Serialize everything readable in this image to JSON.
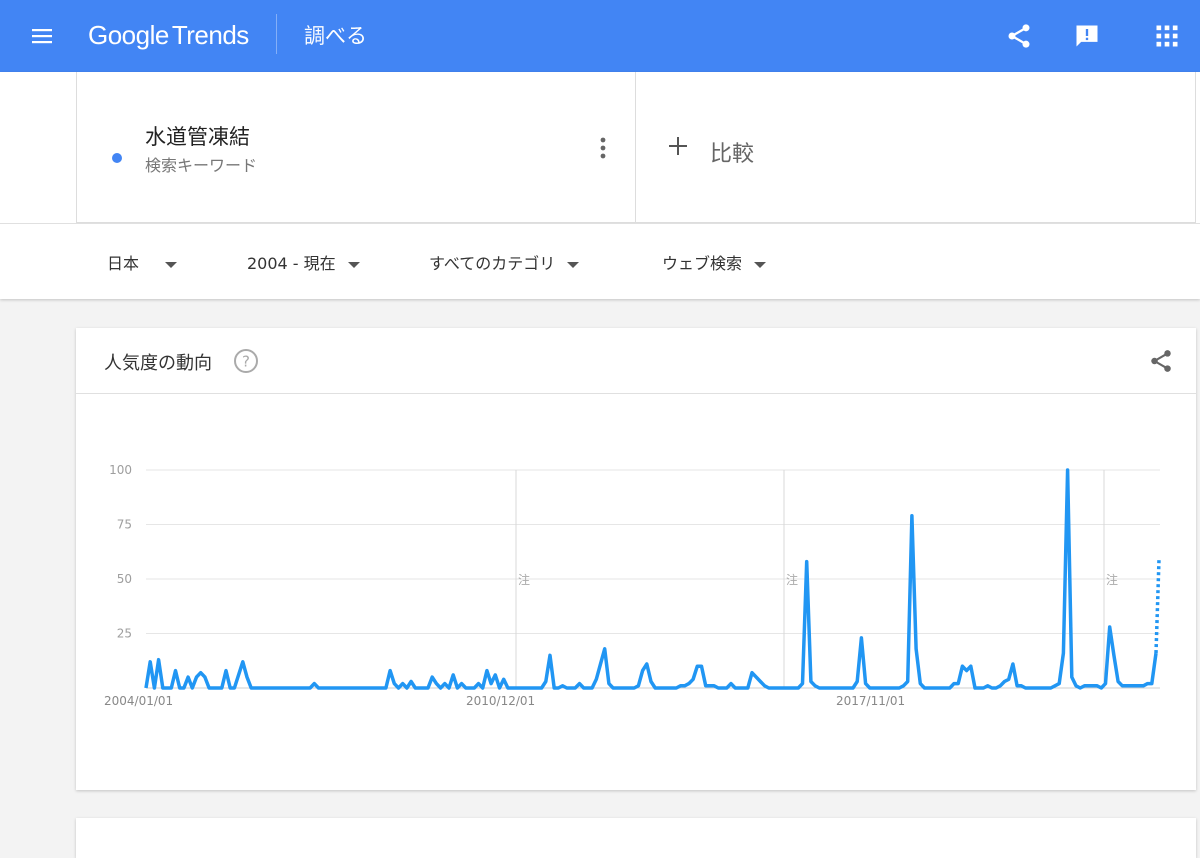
{
  "appbar": {
    "logo_google": "Google",
    "logo_trends": "Trends",
    "title": "調べる",
    "bg_color": "#4285f4"
  },
  "term": {
    "name": "水道管凍結",
    "subtitle": "検索キーワード",
    "color": "#4285f4"
  },
  "compare": {
    "label": "比較"
  },
  "filters": [
    {
      "label": "日本"
    },
    {
      "label": "2004 - 現在"
    },
    {
      "label": "すべてのカテゴリ"
    },
    {
      "label": "ウェブ検索"
    }
  ],
  "chart_section": {
    "title": "人気度の動向"
  },
  "chart_data": {
    "type": "line",
    "x_labels": [
      "2004/01/01",
      "2010/12/01",
      "2017/11/01"
    ],
    "y_ticks": [
      25,
      50,
      75,
      100
    ],
    "ylim": [
      0,
      100
    ],
    "note_label": "注",
    "series": [
      {
        "color": "#2196f3",
        "values": [
          0,
          12,
          0,
          13,
          0,
          0,
          0,
          8,
          0,
          0,
          5,
          0,
          5,
          7,
          5,
          0,
          0,
          0,
          0,
          8,
          0,
          0,
          6,
          12,
          5,
          0,
          0,
          0,
          0,
          0,
          0,
          0,
          0,
          0,
          0,
          0,
          0,
          0,
          0,
          0,
          2,
          0,
          0,
          0,
          0,
          0,
          0,
          0,
          0,
          0,
          0,
          0,
          0,
          0,
          0,
          0,
          0,
          0,
          8,
          2,
          0,
          2,
          0,
          3,
          0,
          0,
          0,
          0,
          5,
          2,
          0,
          2,
          0,
          6,
          0,
          2,
          0,
          0,
          0,
          2,
          0,
          8,
          2,
          6,
          0,
          4,
          0,
          0,
          0,
          0,
          0,
          0,
          0,
          0,
          0,
          3,
          15,
          0,
          0,
          1,
          0,
          0,
          0,
          2,
          0,
          0,
          0,
          4,
          11,
          18,
          2,
          0,
          0,
          0,
          0,
          0,
          0,
          1,
          8,
          11,
          3,
          0,
          0,
          0,
          0,
          0,
          0,
          1,
          1,
          2,
          4,
          10,
          10,
          1,
          1,
          1,
          0,
          0,
          0,
          2,
          0,
          0,
          0,
          0,
          7,
          5,
          3,
          1,
          0,
          0,
          0,
          0,
          0,
          0,
          0,
          0,
          2,
          58,
          3,
          1,
          0,
          0,
          0,
          0,
          0,
          0,
          0,
          0,
          0,
          3,
          23,
          2,
          0,
          0,
          0,
          0,
          0,
          0,
          0,
          0,
          1,
          3,
          79,
          18,
          2,
          0,
          0,
          0,
          0,
          0,
          0,
          0,
          2,
          2,
          10,
          8,
          10,
          0,
          0,
          0,
          1,
          0,
          0,
          1,
          3,
          4,
          11,
          1,
          1,
          0,
          0,
          0,
          0,
          0,
          0,
          0,
          1,
          2,
          16,
          100,
          5,
          1,
          0,
          1,
          1,
          1,
          1,
          0,
          2,
          28,
          15,
          3,
          1,
          1,
          1,
          1,
          1,
          1,
          2,
          2,
          16
        ],
        "partial_last": 59
      }
    ]
  }
}
